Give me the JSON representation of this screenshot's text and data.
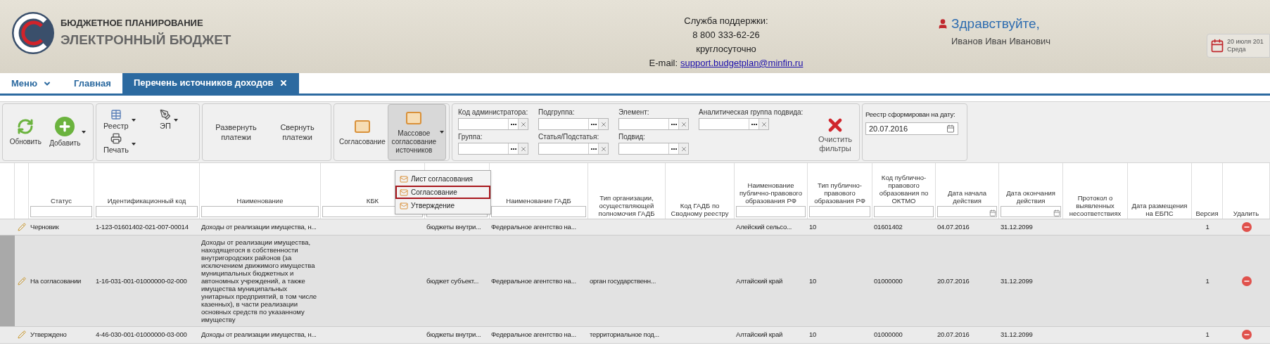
{
  "header": {
    "logo_line1": "БЮДЖЕТНОЕ ПЛАНИРОВАНИЕ",
    "logo_line2": "ЭЛЕКТРОННЫЙ БЮДЖЕТ",
    "support": {
      "title": "Служба поддержки:",
      "phone": "8 800 333-62-26",
      "hours": "круглосуточно",
      "email_label": "E-mail:",
      "email": "support.budgetplan@minfin.ru"
    },
    "user": {
      "greeting": "Здравствуйте,",
      "name": "Иванов Иван Иванович"
    },
    "date": {
      "date": "20 июля 201",
      "weekday": "Среда"
    }
  },
  "nav": [
    {
      "kind": "menu",
      "label": "Меню",
      "selected": false
    },
    {
      "kind": "link",
      "label": "Главная",
      "selected": false
    },
    {
      "kind": "tab",
      "label": "Перечень источников доходов",
      "selected": true
    }
  ],
  "toolbar": {
    "groups": [
      [
        {
          "kind": "refresh",
          "label": "Обновить",
          "dropdown": false,
          "pressed": false
        },
        {
          "kind": "add",
          "label": "Добавить",
          "dropdown": true,
          "pressed": false
        }
      ],
      [
        {
          "kind": "registry",
          "label": "Реестр",
          "dropdown": true,
          "pressed": false
        },
        {
          "kind": "sign",
          "label": "ЭП",
          "dropdown": true,
          "pressed": false
        },
        {
          "kind": "print",
          "label": "Печать",
          "dropdown": true,
          "pressed": false
        }
      ],
      [
        {
          "kind": "text",
          "label": "Развернуть платежи",
          "dropdown": false,
          "pressed": false
        },
        {
          "kind": "text",
          "label": "Свернуть платежи",
          "dropdown": false,
          "pressed": false
        }
      ],
      [
        {
          "kind": "approve",
          "label": "Согласование",
          "dropdown": false,
          "pressed": false
        },
        {
          "kind": "approve",
          "label": "Массовое согласование источников",
          "dropdown": true,
          "pressed": true
        }
      ]
    ],
    "filters": [
      {
        "label": "Код администратора:"
      },
      {
        "label": "Подгруппа:"
      },
      {
        "label": "Элемент:"
      },
      {
        "label": "Аналитическая группа подвида:"
      },
      {
        "label": "Группа:"
      },
      {
        "label": "Статья/Подстатья:"
      },
      {
        "label": "Подвид:"
      }
    ],
    "clear_button": "Очистить фильтры",
    "registry_date": {
      "label": "Реестр сформирован на дату:",
      "value": "20.07.2016"
    }
  },
  "dropdown_menu": [
    {
      "label": "Лист согласования",
      "selected": false
    },
    {
      "label": "Согласование",
      "selected": true
    },
    {
      "label": "Утверждение",
      "selected": false
    }
  ],
  "table": {
    "columns": [
      {
        "kind": "plain"
      },
      {
        "kind": "plain"
      },
      {
        "label": "Статус",
        "kind": "text-filter"
      },
      {
        "label": "Идентификационный код",
        "kind": "text-filter"
      },
      {
        "label": "Наименование",
        "kind": "text-filter"
      },
      {
        "label": "КБК",
        "kind": "text-filter"
      },
      {
        "kind": "text-filter"
      },
      {
        "label": "Наименование ГАДБ",
        "kind": "text-filter"
      },
      {
        "label": "Тип организации, осуществляющей полномочия ГАДБ",
        "kind": "plain"
      },
      {
        "label": "Код ГАДБ по Сводному реестру",
        "kind": "plain"
      },
      {
        "label": "Наименование публично-правового образования РФ",
        "kind": "text-filter"
      },
      {
        "label": "Тип публично-правового образования РФ",
        "kind": "text-filter"
      },
      {
        "label": "Код публично-правового образования по ОКТМО",
        "kind": "text-filter"
      },
      {
        "label": "Дата начала действия",
        "kind": "date-filter"
      },
      {
        "label": "Дата окончания действия",
        "kind": "date-filter"
      },
      {
        "label": "Протокол о выявленных несоответствиях",
        "kind": "plain"
      },
      {
        "label": "Дата размещения на ЕБПС",
        "kind": "plain"
      },
      {
        "label": "Версия",
        "kind": "plain"
      },
      {
        "label": "Удалить",
        "kind": "plain"
      }
    ],
    "rows": [
      {
        "selected": false,
        "cells": [
          "",
          "",
          "Черновик",
          "1-123-01601402-021-007-00014",
          "Доходы от реализации имущества, н...",
          "",
          "бюджеты внутри...",
          "Федеральное агентство на...",
          "",
          "",
          "Алейский сельсо...",
          "10",
          "01601402",
          "04.07.2016",
          "31.12.2099",
          "",
          "",
          "1",
          ""
        ]
      },
      {
        "selected": true,
        "cells": [
          "",
          "",
          "На согласовании",
          "1-16-031-001-01000000-02-000",
          "Доходы от реализации имущества, находящегося в собственности внутригородских районов (за исключением движимого имущества муниципальных бюджетных и автономных учреждений, а также имущества муниципальных унитарных предприятий, в том числе казенных), в части реализации основных средств по указанному имуществу",
          "",
          "бюджет субъект...",
          "Федеральное агентство на...",
          "орган государственн...",
          "",
          "Алтайский край",
          "10",
          "01000000",
          "20.07.2016",
          "31.12.2099",
          "",
          "",
          "1",
          ""
        ]
      },
      {
        "selected": false,
        "cells": [
          "",
          "",
          "Утверждено",
          "4-46-030-001-01000000-03-000",
          "Доходы от реализации имущества, н...",
          "",
          "бюджеты внутри...",
          "Федеральное агентство на...",
          "территориальное под...",
          "",
          "Алтайский край",
          "10",
          "01000000",
          "20.07.2016",
          "31.12.2099",
          "",
          "",
          "1",
          ""
        ]
      }
    ]
  }
}
